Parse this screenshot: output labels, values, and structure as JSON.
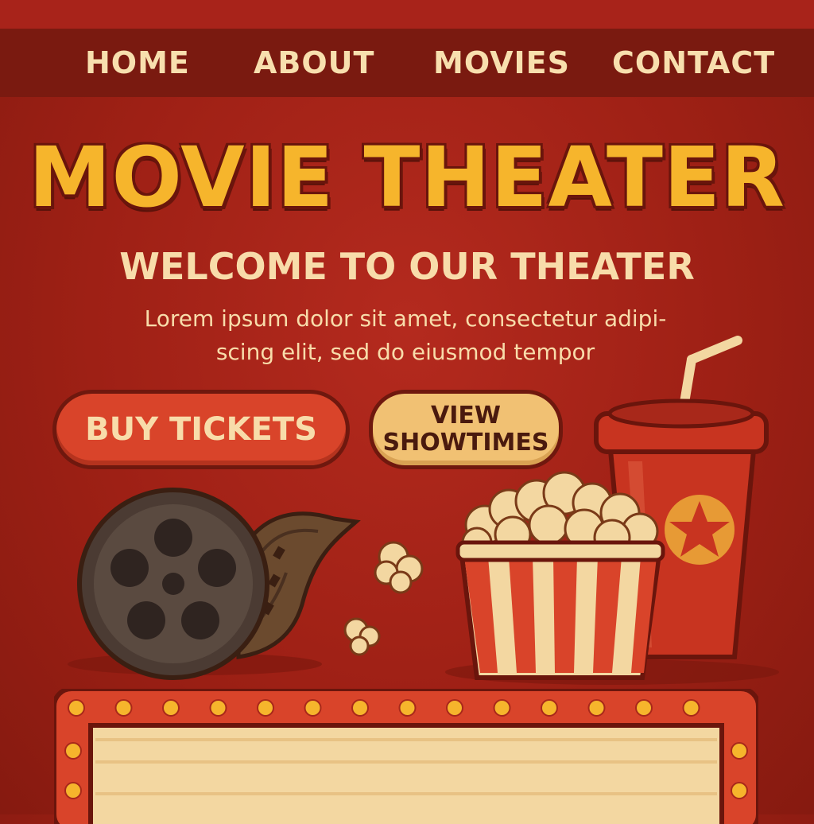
{
  "nav": {
    "items": [
      {
        "label": "HOME"
      },
      {
        "label": "ABOUT"
      },
      {
        "label": "MOVIES"
      },
      {
        "label": "CONTACT"
      }
    ]
  },
  "hero": {
    "title": "MOVIE THEATER",
    "subtitle": "WELCOME TO OUR THEATER",
    "description": "Lorem ipsum dolor sit amet, consectetur adipi-scing elit, sed do eiusmod tempor"
  },
  "actions": {
    "buy_label": "BUY TICKETS",
    "showtimes_label": "VIEW\nSHOWTIMES"
  },
  "icons": [
    "film-reel-icon",
    "popcorn-icon",
    "soda-cup-icon",
    "star-icon",
    "marquee-sign"
  ],
  "colors": {
    "background": "#9e2015",
    "navbar": "#7a1a10",
    "accent_gold": "#f6b52c",
    "cream": "#f8dcaa",
    "button_red": "#d9442a",
    "button_gold": "#f1c173"
  }
}
